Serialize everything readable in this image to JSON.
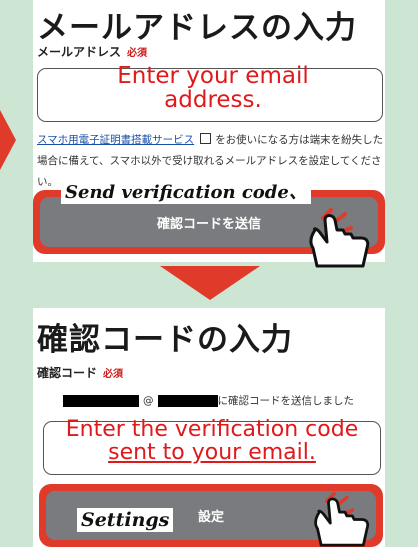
{
  "email_section": {
    "title": "メールアドレスの入力",
    "field_label": "メールアドレス",
    "required": "必須",
    "input_hint": [
      "Enter your email",
      "address."
    ],
    "note_link": "スマホ用電子証明書搭載サービス",
    "note_text": "をお使いになる方は端末を紛失した場合に備えて、スマホ以外で受け取れるメールアドレスを設定してください。",
    "caption": "Send verification code、",
    "button_label": "確認コードを送信"
  },
  "code_section": {
    "title": "確認コードの入力",
    "field_label": "確認コード",
    "required": "必須",
    "masked_at": "@",
    "masked_message": "に確認コードを送信しました",
    "input_hint": [
      "Enter the verification code",
      "sent to your email."
    ],
    "caption": "Settings",
    "button_label": "設定"
  },
  "icons": [
    "external-link-icon",
    "pointing-hand-icon",
    "arrow-right-icon",
    "arrow-down-icon"
  ],
  "colors": {
    "background": "#cde6d3",
    "accent": "#e03a2a",
    "button": "#7a7b7e",
    "hint": "#e0191b",
    "link": "#1a4ea8"
  }
}
